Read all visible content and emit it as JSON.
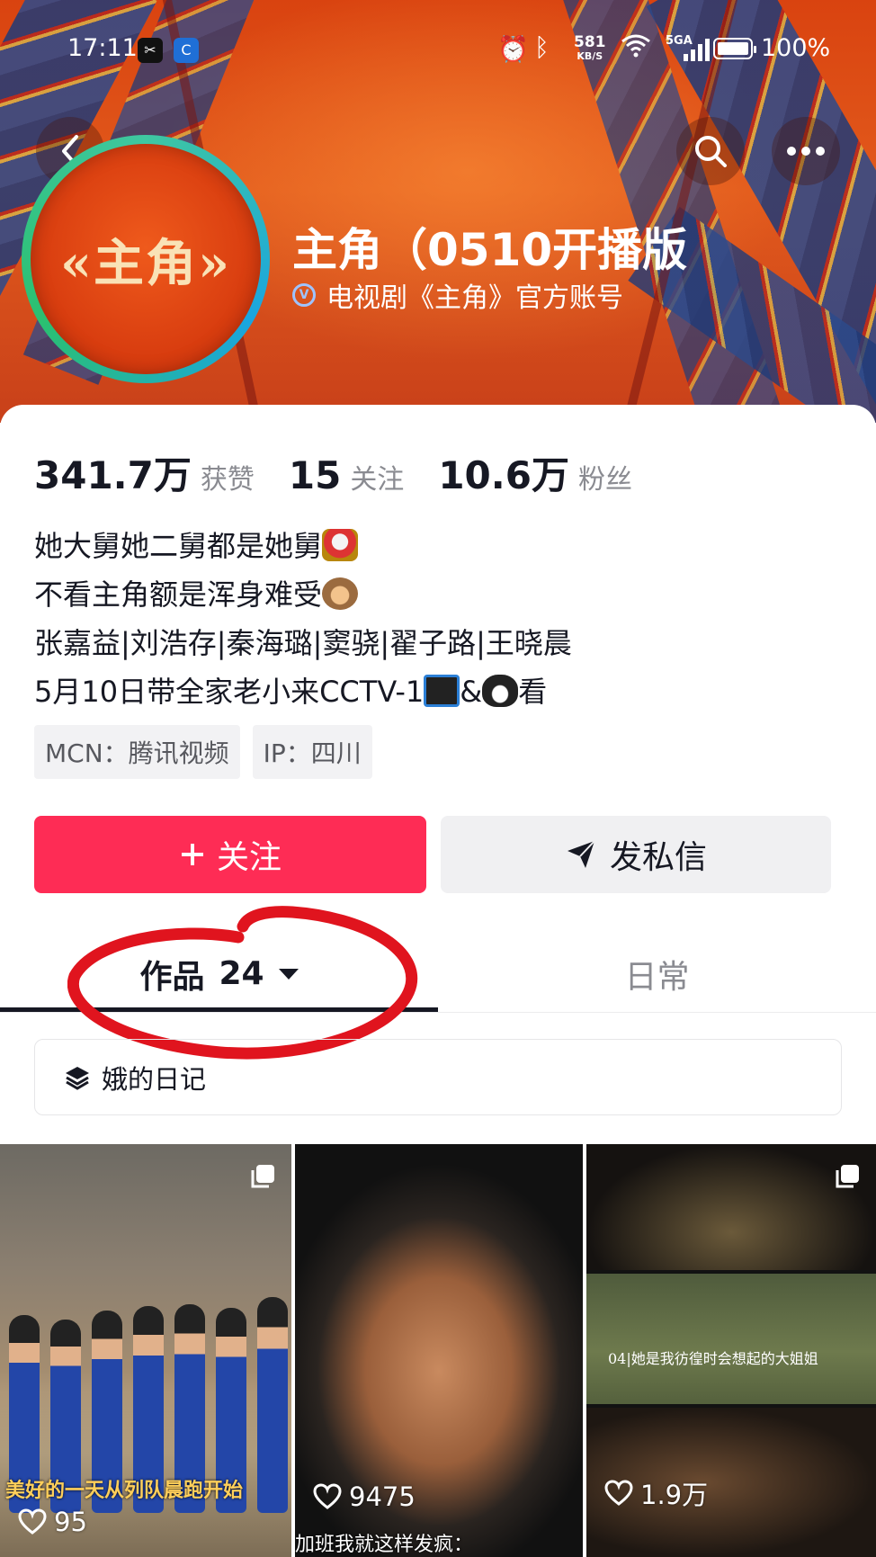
{
  "status_bar": {
    "time": "17:11",
    "net_speed_value": "581",
    "net_speed_unit": "KB/S",
    "signal_label": "5GA",
    "battery": "100%"
  },
  "profile": {
    "nickname": "主角（0510开播版",
    "verify_text": "电视剧《主角》官方账号",
    "avatar_text": "«主角»"
  },
  "stats": [
    {
      "value": "341.7万",
      "label": "获赞"
    },
    {
      "value": "15",
      "label": "关注"
    },
    {
      "value": "10.6万",
      "label": "粉丝"
    }
  ],
  "bio": {
    "line1": "她大舅她二舅都是她舅",
    "line2": "不看主角额是浑身难受",
    "line3": "张嘉益|刘浩存|秦海璐|窦骁|翟子路|王晓晨",
    "line4a": "5月10日带全家老小来CCTV-1",
    "line4b": "&",
    "line4c": "看"
  },
  "tags": {
    "mcn": "MCN：腾讯视频",
    "ip": "IP：四川"
  },
  "buttons": {
    "follow": "关注",
    "message": "发私信"
  },
  "tabs": {
    "works_label": "作品",
    "works_count": "24",
    "daily_label": "日常"
  },
  "collection": {
    "label": "娥的日记"
  },
  "videos": [
    {
      "likes": "95",
      "caption": "美好的一天从列队晨跑开始"
    },
    {
      "likes": "9475",
      "caption": "加班我就这样发疯："
    },
    {
      "likes": "1.9万",
      "caption": "04|她是我彷徨时会想起的大姐姐"
    }
  ],
  "colors": {
    "follow_button": "#fe2c55",
    "annotation_circle": "#e0141e"
  }
}
